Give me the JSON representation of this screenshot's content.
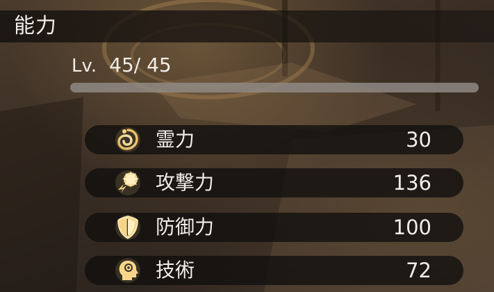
{
  "header": {
    "title": "能力"
  },
  "level": {
    "prefix": "Lv.",
    "value": "45/ 45",
    "progress": 1.0
  },
  "stats": [
    {
      "label": "霊力",
      "value": "30",
      "icon": "spirit-swirl-icon"
    },
    {
      "label": "攻撃力",
      "value": "136",
      "icon": "attack-burst-icon"
    },
    {
      "label": "防御力",
      "value": "100",
      "icon": "shield-icon"
    },
    {
      "label": "技術",
      "value": "72",
      "icon": "head-technique-icon"
    }
  ],
  "colors": {
    "text": "#f2ede6",
    "icon_gold": "#f6d58a",
    "row_bg": "#100e0d"
  }
}
